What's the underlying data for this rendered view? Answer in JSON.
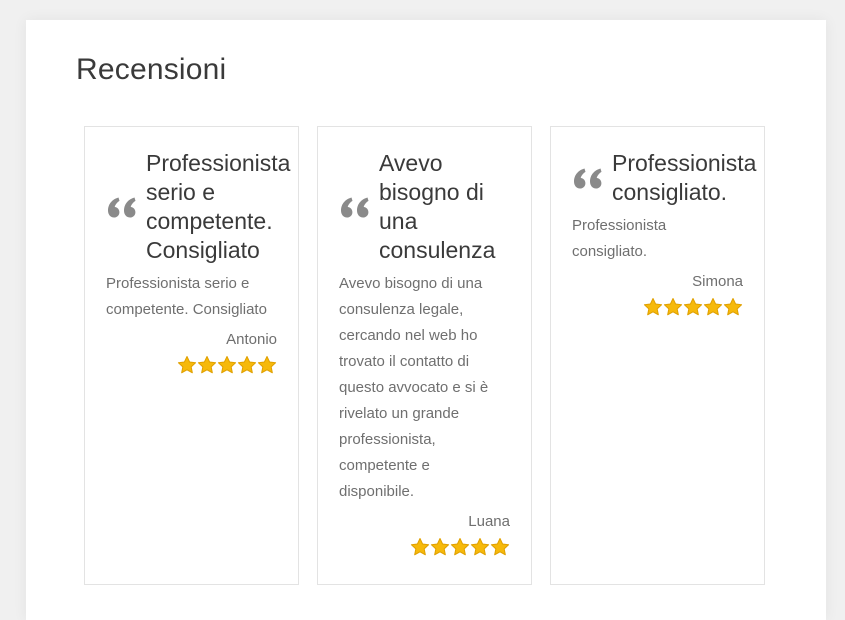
{
  "section": {
    "title": "Recensioni"
  },
  "colors": {
    "star": "#f6b90b",
    "star_outline": "#e0a000",
    "quote": "#8a8a8a"
  },
  "reviews": [
    {
      "title_lines": [
        "Professionista",
        "serio e",
        "competente.",
        "Consigliato"
      ],
      "body_lines": [
        "Professionista serio e",
        "competente. Consigliato"
      ],
      "author": "Antonio",
      "rating": 5
    },
    {
      "title_lines": [
        "Avevo",
        "bisogno di",
        "una",
        "consulenza"
      ],
      "body_lines": [
        "Avevo bisogno di una",
        "consulenza legale,",
        "cercando nel web ho",
        "trovato il contatto di",
        "questo avvocato e si è",
        "rivelato un grande",
        "professionista,",
        "competente e",
        "disponibile."
      ],
      "author": "Luana",
      "rating": 5
    },
    {
      "title_lines": [
        "Professionista",
        "consigliato."
      ],
      "body_lines": [
        "Professionista",
        "consigliato."
      ],
      "author": "Simona",
      "rating": 5
    }
  ]
}
